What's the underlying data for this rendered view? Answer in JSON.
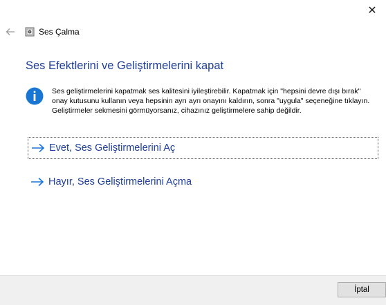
{
  "window": {
    "close_glyph": "✕"
  },
  "header": {
    "app_title": "Ses Çalma",
    "back_icon": "back-arrow-icon",
    "app_icon": "sound-speaker-icon"
  },
  "main": {
    "title": "Ses Efektlerini ve Geliştirmelerini kapat",
    "info": {
      "icon": "info-icon",
      "text": "Ses geliştirmelerini kapatmak ses kalitesini iyileştirebilir. Kapatmak için \"hepsini devre dışı bırak\" onay kutusunu kullanın veya hepsinin ayrı ayrı onayını kaldırın, sonra \"uygula\" seçeneğine tıklayın. Geliştirmeler sekmesini görmüyorsanız, cihazınız geliştirmelere sahip değildir."
    },
    "options": [
      {
        "label": "Evet, Ses Geliştirmelerini Aç",
        "icon": "right-arrow-icon"
      },
      {
        "label": "Hayır, Ses Geliştirmelerini Açma",
        "icon": "right-arrow-icon"
      }
    ]
  },
  "footer": {
    "cancel_label": "İptal"
  },
  "colors": {
    "accent": "#1e3f9a",
    "info_blue": "#1976d2",
    "arrow_blue": "#1a73d9",
    "footer_bg": "#f0f0f0"
  }
}
